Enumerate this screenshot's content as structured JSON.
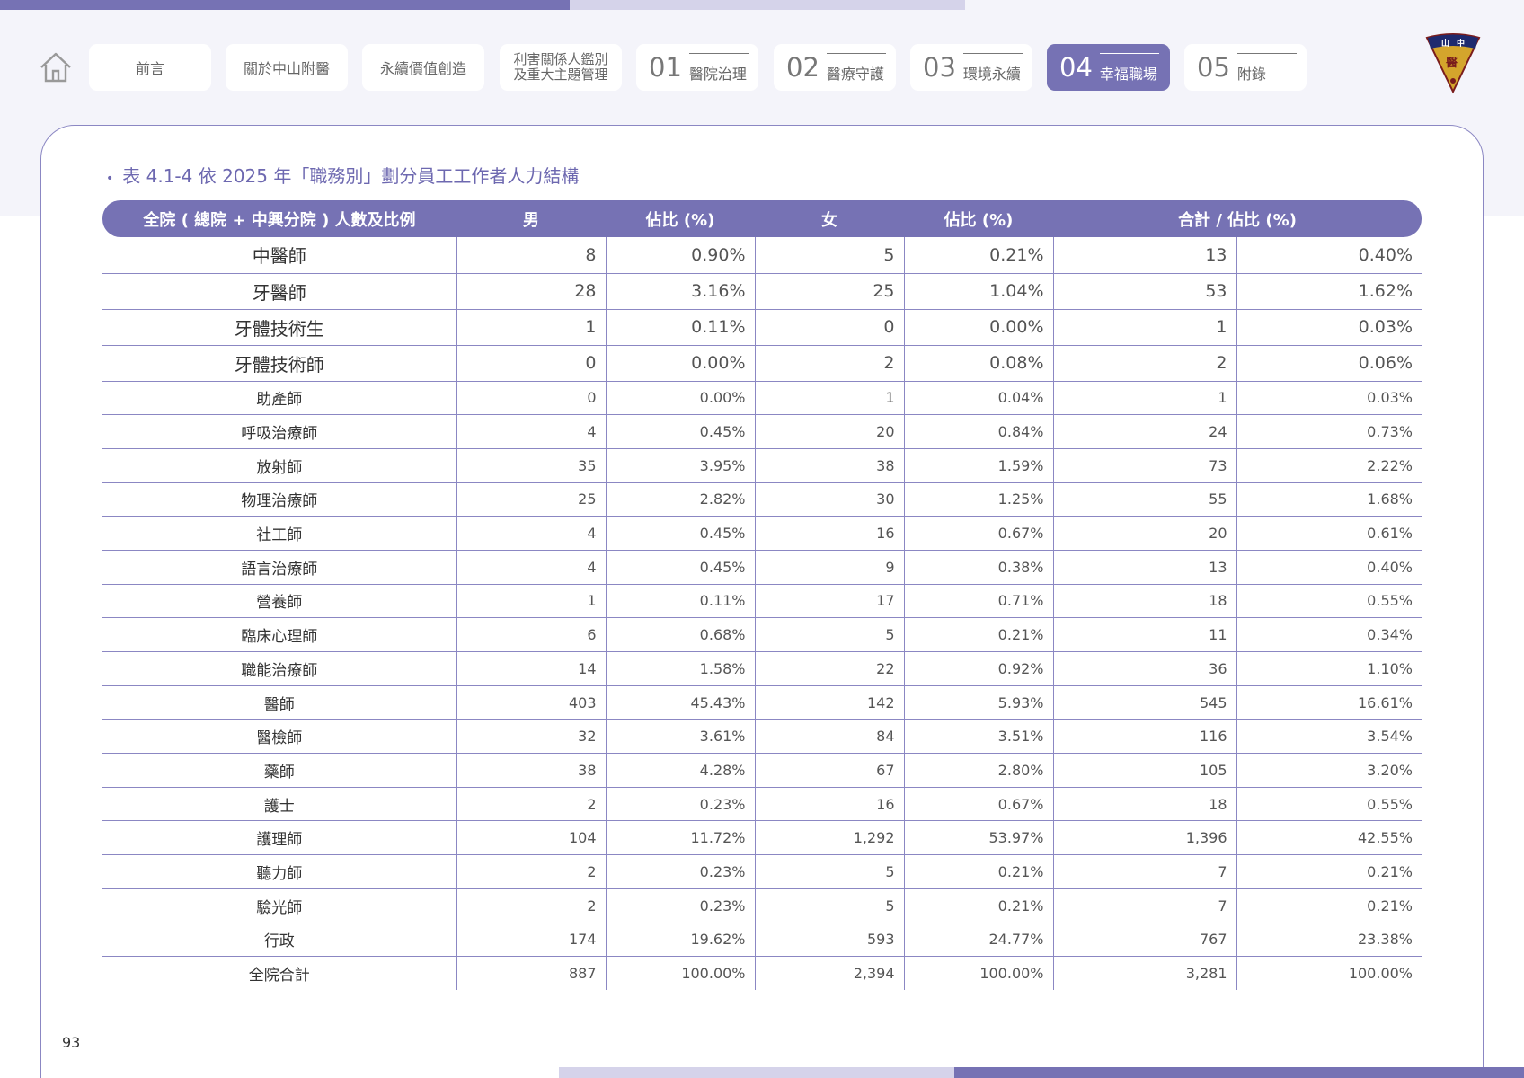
{
  "nav": {
    "items": [
      {
        "label": "前言"
      },
      {
        "label": "關於中山附醫"
      },
      {
        "label": "永續價值創造"
      },
      {
        "label": "利害關係人鑑別\n及重大主題管理"
      },
      {
        "num": "01",
        "label": "醫院治理"
      },
      {
        "num": "02",
        "label": "醫療守護"
      },
      {
        "num": "03",
        "label": "環境永續"
      },
      {
        "num": "04",
        "label": "幸福職場"
      },
      {
        "num": "05",
        "label": "附錄"
      }
    ],
    "active_index": 7,
    "logo_text": "中山 醫"
  },
  "title": "表 4.1-4 依 2025 年「職務別」劃分員工工作者人力結構",
  "table": {
    "headers": [
      "全院 ( 總院 + 中興分院 ) 人數及比例",
      "男",
      "佔比 (%)",
      "女",
      "佔比 (%)",
      "合計 / 佔比 (%)"
    ],
    "rows": [
      [
        "中醫師",
        "8",
        "0.90%",
        "5",
        "0.21%",
        "13",
        "0.40%"
      ],
      [
        "牙醫師",
        "28",
        "3.16%",
        "25",
        "1.04%",
        "53",
        "1.62%"
      ],
      [
        "牙體技術生",
        "1",
        "0.11%",
        "0",
        "0.00%",
        "1",
        "0.03%"
      ],
      [
        "牙體技術師",
        "0",
        "0.00%",
        "2",
        "0.08%",
        "2",
        "0.06%"
      ],
      [
        "助產師",
        "0",
        "0.00%",
        "1",
        "0.04%",
        "1",
        "0.03%"
      ],
      [
        "呼吸治療師",
        "4",
        "0.45%",
        "20",
        "0.84%",
        "24",
        "0.73%"
      ],
      [
        "放射師",
        "35",
        "3.95%",
        "38",
        "1.59%",
        "73",
        "2.22%"
      ],
      [
        "物理治療師",
        "25",
        "2.82%",
        "30",
        "1.25%",
        "55",
        "1.68%"
      ],
      [
        "社工師",
        "4",
        "0.45%",
        "16",
        "0.67%",
        "20",
        "0.61%"
      ],
      [
        "語言治療師",
        "4",
        "0.45%",
        "9",
        "0.38%",
        "13",
        "0.40%"
      ],
      [
        "營養師",
        "1",
        "0.11%",
        "17",
        "0.71%",
        "18",
        "0.55%"
      ],
      [
        "臨床心理師",
        "6",
        "0.68%",
        "5",
        "0.21%",
        "11",
        "0.34%"
      ],
      [
        "職能治療師",
        "14",
        "1.58%",
        "22",
        "0.92%",
        "36",
        "1.10%"
      ],
      [
        "醫師",
        "403",
        "45.43%",
        "142",
        "5.93%",
        "545",
        "16.61%"
      ],
      [
        "醫檢師",
        "32",
        "3.61%",
        "84",
        "3.51%",
        "116",
        "3.54%"
      ],
      [
        "藥師",
        "38",
        "4.28%",
        "67",
        "2.80%",
        "105",
        "3.20%"
      ],
      [
        "護士",
        "2",
        "0.23%",
        "16",
        "0.67%",
        "18",
        "0.55%"
      ],
      [
        "護理師",
        "104",
        "11.72%",
        "1,292",
        "53.97%",
        "1,396",
        "42.55%"
      ],
      [
        "聽力師",
        "2",
        "0.23%",
        "5",
        "0.21%",
        "7",
        "0.21%"
      ],
      [
        "驗光師",
        "2",
        "0.23%",
        "5",
        "0.21%",
        "7",
        "0.21%"
      ],
      [
        "行政",
        "174",
        "19.62%",
        "593",
        "24.77%",
        "767",
        "23.38%"
      ],
      [
        "全院合計",
        "887",
        "100.00%",
        "2,394",
        "100.00%",
        "3,281",
        "100.00%"
      ]
    ]
  },
  "page_number": "93",
  "colors": {
    "accent": "#7672b4",
    "accent_light": "#d5d3ea",
    "band": "#f4f4fa"
  }
}
